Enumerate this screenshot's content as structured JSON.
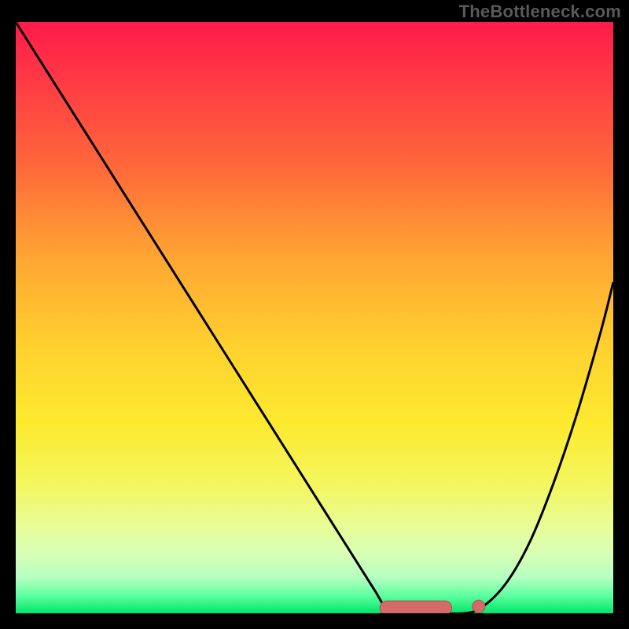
{
  "watermark": "TheBottleneck.com",
  "colors": {
    "background": "#000000",
    "watermark": "#5a5a5a",
    "curve_stroke": "#000000",
    "marker_fill": "#d56a6a",
    "marker_stroke": "#b24d4d"
  },
  "chart_data": {
    "type": "line",
    "title": "",
    "xlabel": "",
    "ylabel": "",
    "xlim": [
      0,
      100
    ],
    "ylim": [
      0,
      100
    ],
    "grid": false,
    "legend": false,
    "annotations": [],
    "background_gradient": {
      "direction": "vertical",
      "stops": [
        {
          "pct": 0,
          "meaning": "high-bottleneck",
          "color": "#ff1a4b"
        },
        {
          "pct": 50,
          "meaning": "medium-bottleneck",
          "color": "#ffd12f"
        },
        {
          "pct": 100,
          "meaning": "no-bottleneck",
          "color": "#00e66a"
        }
      ]
    },
    "series": [
      {
        "name": "bottleneck-curve",
        "x": [
          0,
          5,
          10,
          15,
          20,
          25,
          30,
          35,
          40,
          45,
          50,
          55,
          60,
          62,
          65,
          70,
          75,
          78,
          82,
          86,
          90,
          94,
          98,
          100
        ],
        "values": [
          100,
          92,
          84,
          76,
          68,
          60,
          52,
          44,
          36,
          28,
          20,
          12,
          4,
          1,
          0,
          0,
          0,
          1,
          5,
          12,
          22,
          34,
          48,
          56
        ],
        "note": "y = bottleneck percent; 0 at trough ~x=62..78"
      }
    ],
    "markers": {
      "name": "optimal-range-markers",
      "shape": "rounded-pill",
      "color": "#d56a6a",
      "points_x": [
        62,
        78
      ],
      "points_y": [
        0,
        0
      ]
    }
  }
}
